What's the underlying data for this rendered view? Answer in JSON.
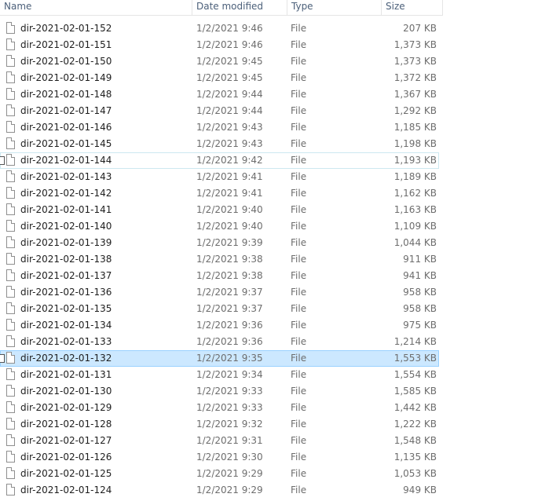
{
  "columns": {
    "name": "Name",
    "date_modified": "Date modified",
    "type": "Type",
    "size": "Size"
  },
  "files": [
    {
      "name": "dir-2021-02-01-152",
      "date": "1/2/2021 9:46",
      "type": "File",
      "size": "207 KB"
    },
    {
      "name": "dir-2021-02-01-151",
      "date": "1/2/2021 9:46",
      "type": "File",
      "size": "1,373 KB"
    },
    {
      "name": "dir-2021-02-01-150",
      "date": "1/2/2021 9:45",
      "type": "File",
      "size": "1,373 KB"
    },
    {
      "name": "dir-2021-02-01-149",
      "date": "1/2/2021 9:45",
      "type": "File",
      "size": "1,372 KB"
    },
    {
      "name": "dir-2021-02-01-148",
      "date": "1/2/2021 9:44",
      "type": "File",
      "size": "1,367 KB"
    },
    {
      "name": "dir-2021-02-01-147",
      "date": "1/2/2021 9:44",
      "type": "File",
      "size": "1,292 KB"
    },
    {
      "name": "dir-2021-02-01-146",
      "date": "1/2/2021 9:43",
      "type": "File",
      "size": "1,185 KB"
    },
    {
      "name": "dir-2021-02-01-145",
      "date": "1/2/2021 9:43",
      "type": "File",
      "size": "1,198 KB"
    },
    {
      "name": "dir-2021-02-01-144",
      "date": "1/2/2021 9:42",
      "type": "File",
      "size": "1,193 KB"
    },
    {
      "name": "dir-2021-02-01-143",
      "date": "1/2/2021 9:41",
      "type": "File",
      "size": "1,189 KB"
    },
    {
      "name": "dir-2021-02-01-142",
      "date": "1/2/2021 9:41",
      "type": "File",
      "size": "1,162 KB"
    },
    {
      "name": "dir-2021-02-01-141",
      "date": "1/2/2021 9:40",
      "type": "File",
      "size": "1,163 KB"
    },
    {
      "name": "dir-2021-02-01-140",
      "date": "1/2/2021 9:40",
      "type": "File",
      "size": "1,109 KB"
    },
    {
      "name": "dir-2021-02-01-139",
      "date": "1/2/2021 9:39",
      "type": "File",
      "size": "1,044 KB"
    },
    {
      "name": "dir-2021-02-01-138",
      "date": "1/2/2021 9:38",
      "type": "File",
      "size": "911 KB"
    },
    {
      "name": "dir-2021-02-01-137",
      "date": "1/2/2021 9:38",
      "type": "File",
      "size": "941 KB"
    },
    {
      "name": "dir-2021-02-01-136",
      "date": "1/2/2021 9:37",
      "type": "File",
      "size": "958 KB"
    },
    {
      "name": "dir-2021-02-01-135",
      "date": "1/2/2021 9:37",
      "type": "File",
      "size": "958 KB"
    },
    {
      "name": "dir-2021-02-01-134",
      "date": "1/2/2021 9:36",
      "type": "File",
      "size": "975 KB"
    },
    {
      "name": "dir-2021-02-01-133",
      "date": "1/2/2021 9:36",
      "type": "File",
      "size": "1,214 KB"
    },
    {
      "name": "dir-2021-02-01-132",
      "date": "1/2/2021 9:35",
      "type": "File",
      "size": "1,553 KB"
    },
    {
      "name": "dir-2021-02-01-131",
      "date": "1/2/2021 9:34",
      "type": "File",
      "size": "1,554 KB"
    },
    {
      "name": "dir-2021-02-01-130",
      "date": "1/2/2021 9:33",
      "type": "File",
      "size": "1,585 KB"
    },
    {
      "name": "dir-2021-02-01-129",
      "date": "1/2/2021 9:33",
      "type": "File",
      "size": "1,442 KB"
    },
    {
      "name": "dir-2021-02-01-128",
      "date": "1/2/2021 9:32",
      "type": "File",
      "size": "1,222 KB"
    },
    {
      "name": "dir-2021-02-01-127",
      "date": "1/2/2021 9:31",
      "type": "File",
      "size": "1,548 KB"
    },
    {
      "name": "dir-2021-02-01-126",
      "date": "1/2/2021 9:30",
      "type": "File",
      "size": "1,135 KB"
    },
    {
      "name": "dir-2021-02-01-125",
      "date": "1/2/2021 9:29",
      "type": "File",
      "size": "1,053 KB"
    },
    {
      "name": "dir-2021-02-01-124",
      "date": "1/2/2021 9:29",
      "type": "File",
      "size": "949 KB"
    }
  ],
  "state": {
    "focused_file": "dir-2021-02-01-144",
    "selected_file": "dir-2021-02-01-132"
  },
  "icons": {
    "file": "file-icon"
  },
  "colors": {
    "header_text": "#4c607a",
    "selection_fill": "#cce8ff",
    "selection_border": "#99d1ff",
    "focus_border": "#cde8f0"
  }
}
